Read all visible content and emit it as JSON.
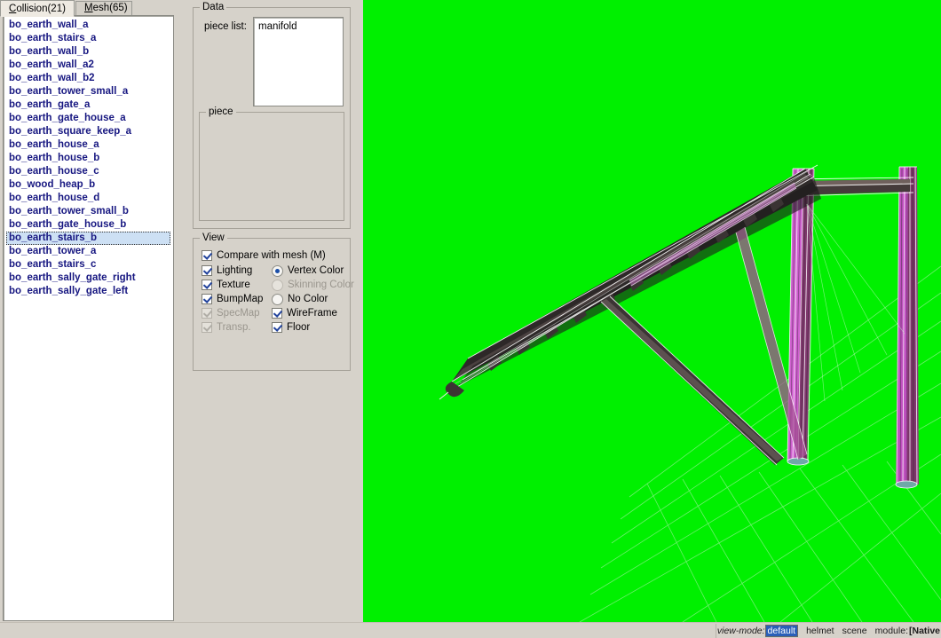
{
  "window": {
    "background_color": "#d6d2ca",
    "viewport_background_color": "#00f000"
  },
  "tabs": [
    {
      "label": "Collision(21)",
      "accel": "C",
      "active": true
    },
    {
      "label": "Mesh(65)",
      "accel": "M",
      "active": false
    }
  ],
  "collision_list": {
    "selected_index": 16,
    "items": [
      "bo_earth_wall_a",
      "bo_earth_stairs_a",
      "bo_earth_wall_b",
      "bo_earth_wall_a2",
      "bo_earth_wall_b2",
      "bo_earth_tower_small_a",
      "bo_earth_gate_a",
      "bo_earth_gate_house_a",
      "bo_earth_square_keep_a",
      "bo_earth_house_a",
      "bo_earth_house_b",
      "bo_earth_house_c",
      "bo_wood_heap_b",
      "bo_earth_house_d",
      "bo_earth_tower_small_b",
      "bo_earth_gate_house_b",
      "bo_earth_stairs_b",
      "bo_earth_tower_a",
      "bo_earth_stairs_c",
      "bo_earth_sally_gate_right",
      "bo_earth_sally_gate_left"
    ]
  },
  "data_panel": {
    "title": "Data",
    "piece_list_label": "piece list:",
    "piece_list_items": [
      "manifold"
    ],
    "piece_group_title": "piece"
  },
  "view_panel": {
    "title": "View",
    "checkboxes": [
      {
        "label": "Compare with mesh (M)",
        "checked": true,
        "enabled": true
      },
      {
        "label": "Lighting",
        "checked": true,
        "enabled": true
      },
      {
        "label": "Texture",
        "checked": true,
        "enabled": true
      },
      {
        "label": "BumpMap",
        "checked": true,
        "enabled": true
      },
      {
        "label": "SpecMap",
        "checked": true,
        "enabled": false
      },
      {
        "label": "Transp.",
        "checked": true,
        "enabled": false
      },
      {
        "label": "WireFrame",
        "checked": true,
        "enabled": true
      },
      {
        "label": "Floor",
        "checked": true,
        "enabled": true
      }
    ],
    "radios": [
      {
        "label": "Vertex Color",
        "checked": true,
        "enabled": true
      },
      {
        "label": "Skinning Color",
        "checked": false,
        "enabled": false
      },
      {
        "label": "No Color",
        "checked": false,
        "enabled": true
      }
    ]
  },
  "statusbar": {
    "view_mode_key": "view-mode:",
    "view_mode_value": "default",
    "item_helmet": "helmet",
    "item_scene": "scene",
    "module_key": "module:",
    "module_value": "[Native"
  }
}
